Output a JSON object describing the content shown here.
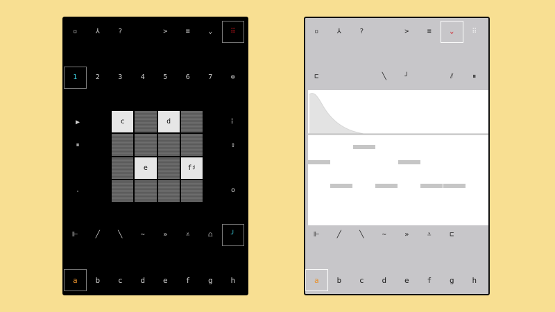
{
  "left_panel": {
    "toolbar": [
      "▫",
      "⅄",
      "?",
      "",
      ">",
      "≡",
      "⌄",
      "⠿"
    ],
    "steps": [
      "1",
      "2",
      "3",
      "4",
      "5",
      "6",
      "7",
      "⊜"
    ],
    "pads": [
      {
        "label": "c",
        "on": true
      },
      {
        "label": "",
        "on": false
      },
      {
        "label": "d",
        "on": true
      },
      {
        "label": "",
        "on": false
      },
      {
        "label": "",
        "on": false
      },
      {
        "label": "",
        "on": false
      },
      {
        "label": "",
        "on": false
      },
      {
        "label": "",
        "on": false
      },
      {
        "label": "",
        "on": false
      },
      {
        "label": "e",
        "on": true
      },
      {
        "label": "",
        "on": false
      },
      {
        "label": "f♯",
        "on": true
      },
      {
        "label": "",
        "on": false
      },
      {
        "label": "",
        "on": false
      },
      {
        "label": "",
        "on": false
      },
      {
        "label": "",
        "on": false
      }
    ],
    "left_side": [
      "▶",
      "⏸",
      "·"
    ],
    "right_side": [
      "⠇",
      "⇕",
      "o"
    ],
    "shapes": [
      "⊩",
      "╱",
      "╲",
      "∼",
      "»",
      "⩡",
      "⩍",
      "╯"
    ],
    "keys": [
      "a",
      "b",
      "c",
      "d",
      "e",
      "f",
      "g",
      "h"
    ]
  },
  "right_panel": {
    "toolbar": [
      "▫",
      "⅄",
      "?",
      "",
      ">",
      "≡",
      "⌄",
      "⠿"
    ],
    "top_row": [
      "⊏",
      "",
      "",
      "╲",
      "╯",
      "",
      "⫽",
      "⏸"
    ],
    "shapes": [
      "⊩",
      "╱",
      "╲",
      "∼",
      "»",
      "⩡",
      "⊏"
    ],
    "keys": [
      "a",
      "b",
      "c",
      "d",
      "e",
      "f",
      "g",
      "h"
    ]
  },
  "colors": {
    "accent": "#e8902a",
    "cyan": "#39c7d8",
    "red": "#d0161e",
    "background": "#f8df92"
  }
}
